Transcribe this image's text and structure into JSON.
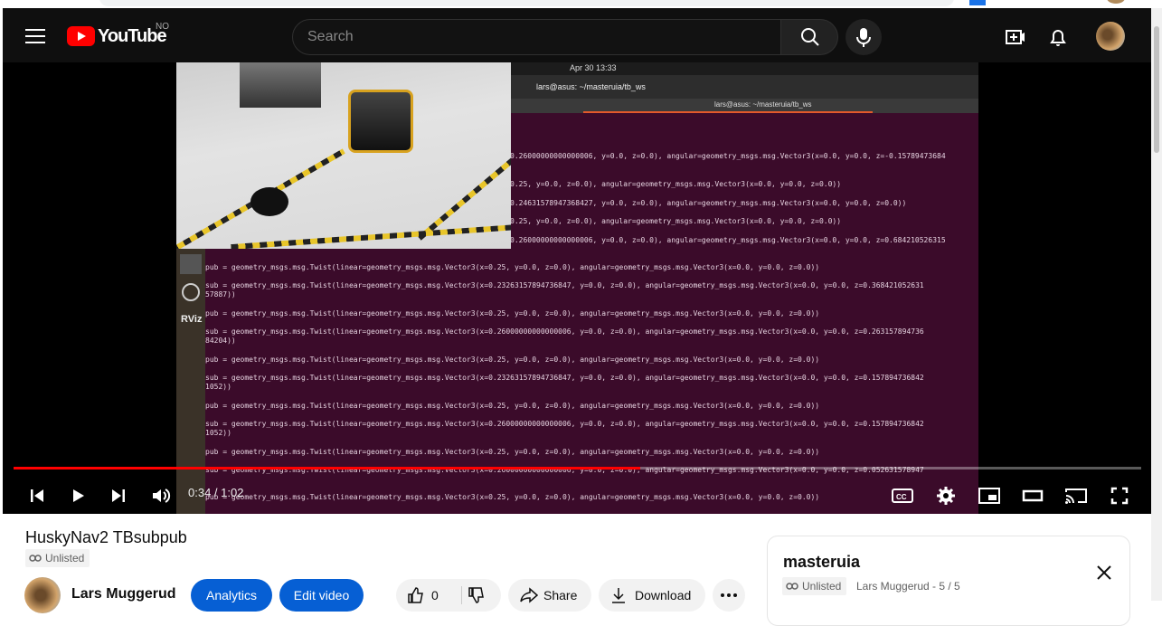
{
  "masthead": {
    "logo_text": "YouTube",
    "country_code": "NO",
    "search_placeholder": "Search",
    "icons": [
      "menu-icon",
      "search-icon",
      "mic-icon",
      "create-icon",
      "bell-icon",
      "avatar"
    ]
  },
  "video_frame": {
    "clock": "Apr 30  13:33",
    "window_title": "lars@asus: ~/masteruia/tb_ws",
    "tab_title": "lars@asus: ~/masteruia/tb_ws",
    "dock_label": "RViz",
    "terminal_lines": [
      "0.26000000000000006, y=0.0, z=0.0), angular=geometry_msgs.msg.Vector3(x=0.0, y=0.0, z=-0.15789473684",
      "0.25, y=0.0, z=0.0), angular=geometry_msgs.msg.Vector3(x=0.0, y=0.0, z=0.0))",
      "0.24631578947368427, y=0.0, z=0.0), angular=geometry_msgs.msg.Vector3(x=0.0, y=0.0, z=0.0))",
      "0.25, y=0.0, z=0.0), angular=geometry_msgs.msg.Vector3(x=0.0, y=0.0, z=0.0))",
      "0.26000000000000006, y=0.0, z=0.0), angular=geometry_msgs.msg.Vector3(x=0.0, y=0.0, z=0.684210526315",
      "pub =  geometry_msgs.msg.Twist(linear=geometry_msgs.msg.Vector3(x=0.25, y=0.0, z=0.0), angular=geometry_msgs.msg.Vector3(x=0.0, y=0.0, z=0.0))",
      "sub =  geometry_msgs.msg.Twist(linear=geometry_msgs.msg.Vector3(x=0.23263157894736847, y=0.0, z=0.0), angular=geometry_msgs.msg.Vector3(x=0.0, y=0.0, z=0.368421052631",
      "57887))",
      "pub =  geometry_msgs.msg.Twist(linear=geometry_msgs.msg.Vector3(x=0.25, y=0.0, z=0.0), angular=geometry_msgs.msg.Vector3(x=0.0, y=0.0, z=0.0))",
      "sub =  geometry_msgs.msg.Twist(linear=geometry_msgs.msg.Vector3(x=0.26000000000000006, y=0.0, z=0.0), angular=geometry_msgs.msg.Vector3(x=0.0, y=0.0, z=0.263157894736",
      "84204))",
      "pub =  geometry_msgs.msg.Twist(linear=geometry_msgs.msg.Vector3(x=0.25, y=0.0, z=0.0), angular=geometry_msgs.msg.Vector3(x=0.0, y=0.0, z=0.0))",
      "sub =  geometry_msgs.msg.Twist(linear=geometry_msgs.msg.Vector3(x=0.23263157894736847, y=0.0, z=0.0), angular=geometry_msgs.msg.Vector3(x=0.0, y=0.0, z=0.157894736842",
      "1052))",
      "pub =  geometry_msgs.msg.Twist(linear=geometry_msgs.msg.Vector3(x=0.25, y=0.0, z=0.0), angular=geometry_msgs.msg.Vector3(x=0.0, y=0.0, z=0.0))",
      "sub =  geometry_msgs.msg.Twist(linear=geometry_msgs.msg.Vector3(x=0.26000000000000006, y=0.0, z=0.0), angular=geometry_msgs.msg.Vector3(x=0.0, y=0.0, z=0.157894736842",
      "1052))",
      "pub =  geometry_msgs.msg.Twist(linear=geometry_msgs.msg.Vector3(x=0.25, y=0.0, z=0.0), angular=geometry_msgs.msg.Vector3(x=0.0, y=0.0, z=0.0))",
      "sub =  geometry_msgs.msg.Twist(linear=geometry_msgs.msg.Vector3(x=0.26000000000000006, y=0.0, z=0.0), angular=geometry_msgs.msg.Vector3(x=0.0, y=0.0, z=0.052631578947",
      "pub =  geometry_msgs.msg.Twist(linear=geometry_msgs.msg.Vector3(x=0.25, y=0.0, z=0.0), angular=geometry_msgs.msg.Vector3(x=0.0, y=0.0, z=0.0))"
    ]
  },
  "player": {
    "current_time": "0:34",
    "duration": "1:02",
    "time_display": "0:34 / 1:02",
    "progress_fraction": 0.556,
    "accent_color": "#ff0000"
  },
  "video": {
    "title": "HuskyNav2 TBsubpub",
    "visibility": "Unlisted",
    "channel_name": "Lars Muggerud"
  },
  "actions": {
    "analytics": "Analytics",
    "edit_video": "Edit video",
    "like_count": "0",
    "share": "Share",
    "download": "Download"
  },
  "playlist_panel": {
    "title": "masteruia",
    "visibility": "Unlisted",
    "meta": "Lars Muggerud - 5 / 5"
  }
}
